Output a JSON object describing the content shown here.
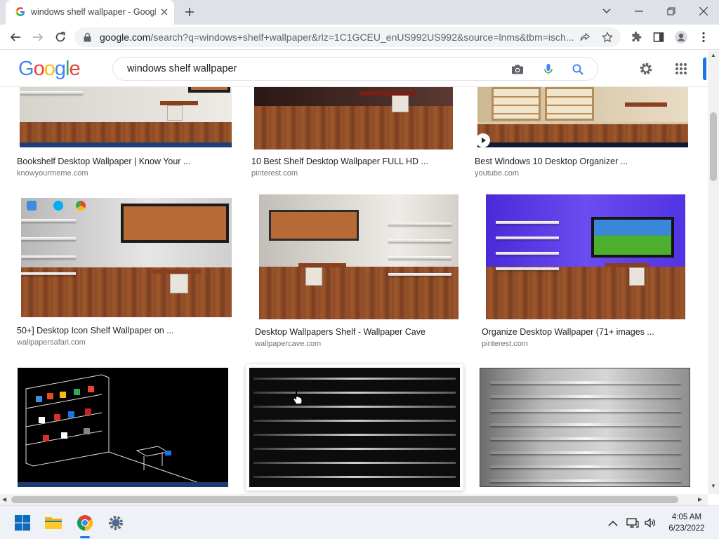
{
  "browser": {
    "tab": {
      "title": "windows shelf wallpaper - Google Search",
      "favicon": "google-g-icon"
    },
    "url": {
      "host": "google.com",
      "rest": "/search?q=windows+shelf+wallpaper&rlz=1C1GCEU_enUS992US992&source=lnms&tbm=isch..."
    }
  },
  "google": {
    "logo_letters": [
      "G",
      "o",
      "o",
      "g",
      "l",
      "e"
    ],
    "logo_colors": [
      "#4285F4",
      "#EA4335",
      "#FBBC05",
      "#4285F4",
      "#34A853",
      "#EA4335"
    ],
    "search_query": "windows shelf wallpaper"
  },
  "results": [
    {
      "title": "Bookshelf Desktop Wallpaper | Know Your ...",
      "source": "knowyourmeme.com"
    },
    {
      "title": "10 Best Shelf Desktop Wallpaper FULL HD ...",
      "source": "pinterest.com"
    },
    {
      "title": "Best Windows 10 Desktop Organizer ...",
      "source": "youtube.com"
    },
    {
      "title": "50+] Desktop Icon Shelf Wallpaper on ...",
      "source": "wallpapersafari.com"
    },
    {
      "title": "Desktop Wallpapers Shelf - Wallpaper Cave",
      "source": "wallpapercave.com"
    },
    {
      "title": "Organize Desktop Wallpaper (71+ images ...",
      "source": "pinterest.com"
    },
    {
      "title": "",
      "source": ""
    },
    {
      "title": "",
      "source": ""
    },
    {
      "title": "",
      "source": ""
    }
  ],
  "taskbar": {
    "apps": [
      "windows-start-icon",
      "file-explorer-icon",
      "chrome-icon",
      "settings-icon"
    ],
    "time": "4:05 AM",
    "date": "6/23/2022"
  },
  "colors": {
    "accent": "#1a73e8",
    "tab_strip": "#dee1e6",
    "omnibox": "#f1f3f4"
  }
}
